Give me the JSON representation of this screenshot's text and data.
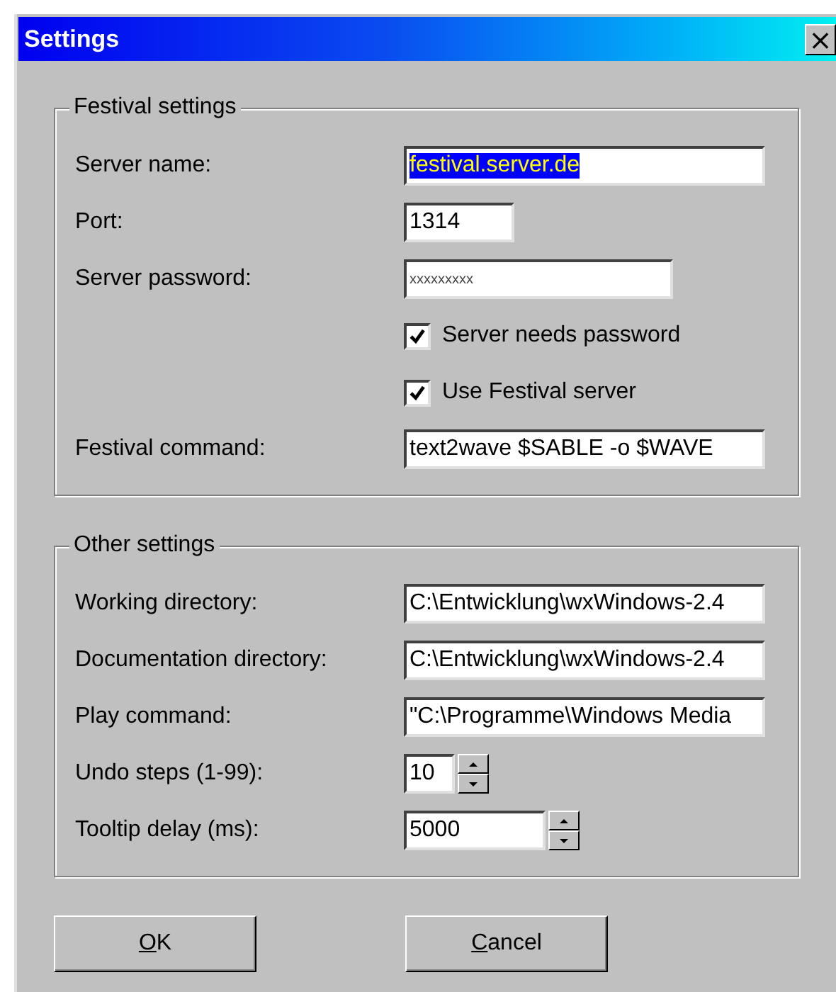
{
  "window": {
    "title": "Settings",
    "close": "×"
  },
  "groups": [
    {
      "title": "Festival settings",
      "rows": [
        {
          "kind": "field",
          "label": "Server name:",
          "value": "festival.server.de",
          "selected": true
        },
        {
          "kind": "field",
          "label": "Port:",
          "value": "1314",
          "selected": false
        },
        {
          "kind": "password",
          "label": "Server password:",
          "value": "xxxxxxxxx",
          "selected": false
        },
        {
          "kind": "checkbox",
          "label": "Server needs password",
          "checked": true
        },
        {
          "kind": "checkbox",
          "label": "Use Festival server",
          "checked": true
        },
        {
          "kind": "field",
          "label": "Festival command:",
          "value": "text2wave $SABLE -o $WAVE",
          "selected": false
        }
      ]
    },
    {
      "title": "Other settings",
      "rows": [
        {
          "kind": "field",
          "label": "Working directory:",
          "value": "C:\\Entwicklung\\wxWindows-2.4",
          "selected": false
        },
        {
          "kind": "field",
          "label": "Documentation directory:",
          "value": "C:\\Entwicklung\\wxWindows-2.4",
          "selected": false
        },
        {
          "kind": "field",
          "label": "Play command:",
          "value": "\"C:\\Programme\\Windows Media",
          "selected": false
        },
        {
          "kind": "spin",
          "label": "Undo steps (1-99):",
          "value": "10"
        },
        {
          "kind": "spin",
          "label": "Tooltip delay (ms):",
          "value": "5000"
        }
      ]
    }
  ],
  "buttons": [
    {
      "mnemonic": "O",
      "rest": "K"
    },
    {
      "mnemonic": "C",
      "rest": "ancel"
    }
  ]
}
